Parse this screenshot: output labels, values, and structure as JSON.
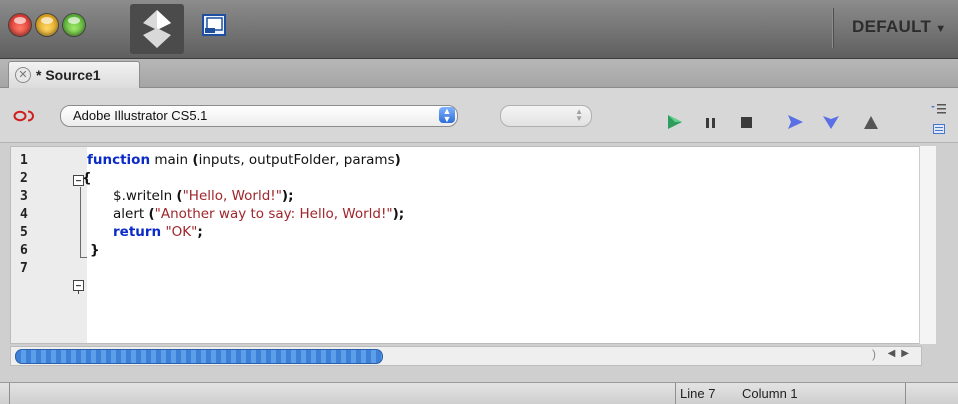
{
  "window": {
    "workspace_label": "DEFAULT",
    "icons": [
      "close-light",
      "minimize-light",
      "zoom-light",
      "extendscript-logo-icon",
      "window-icon",
      "chevron-down-icon"
    ]
  },
  "tabs": [
    {
      "label": "* Source1",
      "close_icon": "close-icon"
    }
  ],
  "toolbar": {
    "target_application": "Adobe Illustrator CS5.1",
    "engine_value": "",
    "buttons": [
      "run-icon",
      "pause-icon",
      "stop-icon",
      "step-over-icon",
      "step-into-icon",
      "step-out-icon"
    ],
    "colors": {
      "run": "#2f9d5d",
      "stepping": "#5a6fe6",
      "stop": "#3a3a3a"
    }
  },
  "editor": {
    "line_numbers": [
      "1",
      "2",
      "3",
      "4",
      "5",
      "6",
      "7"
    ],
    "lines": [
      {
        "kw": "function",
        "text": " main ",
        "p1": "(",
        "args": "inputs, outputFolder, params",
        "p2": ")"
      },
      {
        "brace": "{"
      },
      {
        "text": "$.writeln ",
        "p1": "(",
        "str": "\"Hello, World!\"",
        "p2": ");"
      },
      {
        "text": "alert ",
        "p1": "(",
        "str": "\"Another way to say: Hello, World!\"",
        "p2": ");"
      },
      {
        "kw": "return",
        "str": " \"OK\"",
        "p2": ";"
      },
      {
        "brace": "}"
      },
      {
        "brace": ""
      }
    ]
  },
  "status": {
    "line": "Line 7",
    "column": "Column 1"
  }
}
